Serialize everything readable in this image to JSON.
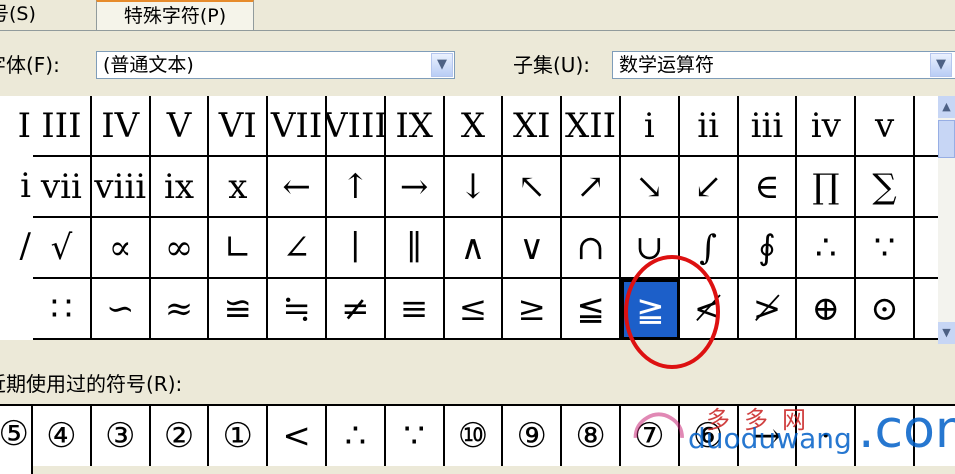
{
  "tabs": {
    "symbols": "号(S)",
    "special": "特殊字符(P)"
  },
  "font": {
    "label": "字体(F):",
    "value": "(普通文本)"
  },
  "subset": {
    "label": "子集(U):",
    "value": "数学运算符"
  },
  "recent_label": "近期使用过的符号(R):",
  "grid_left_fragments": [
    "I",
    "i",
    "/",
    ""
  ],
  "grid": [
    [
      "III",
      "IV",
      "V",
      "VI",
      "VII",
      "VIII",
      "IX",
      "X",
      "XI",
      "XII",
      "i",
      "ii",
      "iii",
      "iv",
      "v",
      ""
    ],
    [
      "vii",
      "viii",
      "ix",
      "x",
      "←",
      "↑",
      "→",
      "↓",
      "↖",
      "↗",
      "↘",
      "↙",
      "∈",
      "∏",
      "∑",
      ""
    ],
    [
      "√",
      "∝",
      "∞",
      "∟",
      "∠",
      "∣",
      "∥",
      "∧",
      "∨",
      "∩",
      "∪",
      "∫",
      "∮",
      "∴",
      "∵",
      ""
    ],
    [
      "∷",
      "∽",
      "≈",
      "≌",
      "≒",
      "≠",
      "≡",
      "≤",
      "≥",
      "≦",
      "≧",
      "≮",
      "≯",
      "⊕",
      "⊙",
      ""
    ]
  ],
  "selected_symbol": "≧",
  "recent_left_fragment": "⑤",
  "recent": [
    "④",
    "③",
    "②",
    "①",
    "<",
    "∴",
    "∵",
    "⑩",
    "⑨",
    "⑧",
    "⑦",
    "⑥",
    "→",
    "·",
    "",
    ""
  ],
  "watermark": {
    "cn": "多多网",
    "en": "duoduwang",
    "com": ".com"
  }
}
